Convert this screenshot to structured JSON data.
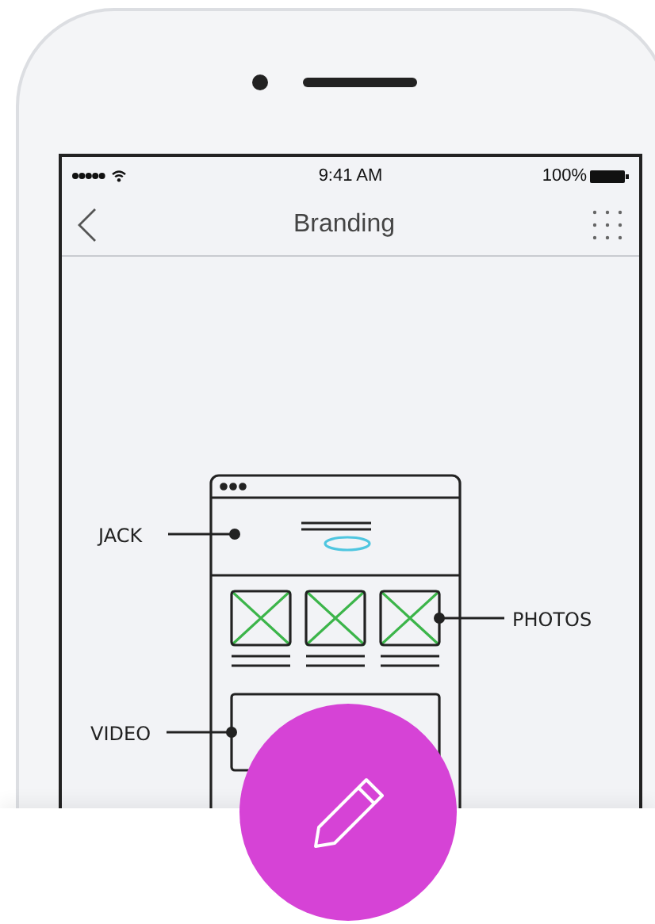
{
  "status_bar": {
    "time": "9:41 AM",
    "battery": "100%"
  },
  "nav_bar": {
    "title": "Branding"
  },
  "sketch": {
    "annotations": [
      {
        "label": "JACK"
      },
      {
        "label": "PHOTOS"
      },
      {
        "label": "VIDEO"
      }
    ]
  }
}
